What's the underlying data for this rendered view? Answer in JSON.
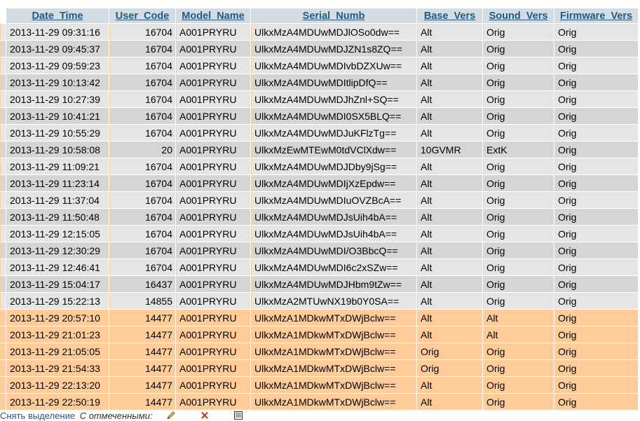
{
  "table": {
    "columns": [
      {
        "label": "Date_Time"
      },
      {
        "label": "User_Code"
      },
      {
        "label": "Model_Name"
      },
      {
        "label": "Serial_Numb"
      },
      {
        "label": "Base_Vers"
      },
      {
        "label": "Sound_Vers"
      },
      {
        "label": "Firmware_Vers"
      }
    ],
    "rows": [
      {
        "style": "odd",
        "cells": [
          "2013-11-29 09:31:16",
          "16704",
          "A001PRYRU",
          "UlkxMzA4MDUwMDJlOSo0dw==",
          "Alt",
          "Orig",
          "Orig"
        ]
      },
      {
        "style": "even",
        "cells": [
          "2013-11-29 09:45:37",
          "16704",
          "A001PRYRU",
          "UlkxMzA4MDUwMDJZN1s8ZQ==",
          "Alt",
          "Orig",
          "Orig"
        ]
      },
      {
        "style": "odd",
        "cells": [
          "2013-11-29 09:59:23",
          "16704",
          "A001PRYRU",
          "UlkxMzA4MDUwMDIvbDZXUw==",
          "Alt",
          "Orig",
          "Orig"
        ]
      },
      {
        "style": "even",
        "cells": [
          "2013-11-29 10:13:42",
          "16704",
          "A001PRYRU",
          "UlkxMzA4MDUwMDItlipDfQ==",
          "Alt",
          "Orig",
          "Orig"
        ]
      },
      {
        "style": "odd",
        "cells": [
          "2013-11-29 10:27:39",
          "16704",
          "A001PRYRU",
          "UlkxMzA4MDUwMDJhZnl+SQ==",
          "Alt",
          "Orig",
          "Orig"
        ]
      },
      {
        "style": "even",
        "cells": [
          "2013-11-29 10:41:21",
          "16704",
          "A001PRYRU",
          "UlkxMzA4MDUwMDI0SX5BLQ==",
          "Alt",
          "Orig",
          "Orig"
        ]
      },
      {
        "style": "odd",
        "cells": [
          "2013-11-29 10:55:29",
          "16704",
          "A001PRYRU",
          "UlkxMzA4MDUwMDJuKFlzTg==",
          "Alt",
          "Orig",
          "Orig"
        ]
      },
      {
        "style": "even",
        "cells": [
          "2013-11-29 10:58:08",
          "20",
          "A001PRYRU",
          "UlkxMzEwMTEwM0tdVClXdw==",
          "10GVMR",
          "ExtK",
          "Orig"
        ]
      },
      {
        "style": "odd",
        "cells": [
          "2013-11-29 11:09:21",
          "16704",
          "A001PRYRU",
          "UlkxMzA4MDUwMDJDby9jSg==",
          "Alt",
          "Orig",
          "Orig"
        ]
      },
      {
        "style": "even",
        "cells": [
          "2013-11-29 11:23:14",
          "16704",
          "A001PRYRU",
          "UlkxMzA4MDUwMDIjXzEpdw==",
          "Alt",
          "Orig",
          "Orig"
        ]
      },
      {
        "style": "odd",
        "cells": [
          "2013-11-29 11:37:04",
          "16704",
          "A001PRYRU",
          "UlkxMzA4MDUwMDIuOVZBcA==",
          "Alt",
          "Orig",
          "Orig"
        ]
      },
      {
        "style": "even",
        "cells": [
          "2013-11-29 11:50:48",
          "16704",
          "A001PRYRU",
          "UlkxMzA4MDUwMDJsUih4bA==",
          "Alt",
          "Orig",
          "Orig"
        ]
      },
      {
        "style": "odd",
        "cells": [
          "2013-11-29 12:15:05",
          "16704",
          "A001PRYRU",
          "UlkxMzA4MDUwMDJsUih4bA==",
          "Alt",
          "Orig",
          "Orig"
        ]
      },
      {
        "style": "even",
        "cells": [
          "2013-11-29 12:30:29",
          "16704",
          "A001PRYRU",
          "UlkxMzA4MDUwMDI/O3BbcQ==",
          "Alt",
          "Orig",
          "Orig"
        ]
      },
      {
        "style": "odd",
        "cells": [
          "2013-11-29 12:46:41",
          "16704",
          "A001PRYRU",
          "UlkxMzA4MDUwMDI6c2xSZw==",
          "Alt",
          "Orig",
          "Orig"
        ]
      },
      {
        "style": "even",
        "cells": [
          "2013-11-29 15:04:17",
          "16437",
          "A001PRYRU",
          "UlkxMzA4MDUwMDJHbm9tZw==",
          "Alt",
          "Orig",
          "Orig"
        ]
      },
      {
        "style": "odd",
        "cells": [
          "2013-11-29 15:22:13",
          "14855",
          "A001PRYRU",
          "UlkxMzA2MTUwNX19b0Y0SA==",
          "Alt",
          "Orig",
          "Orig"
        ]
      },
      {
        "style": "marked",
        "cells": [
          "2013-11-29 20:57:10",
          "14477",
          "A001PRYRU",
          "UlkxMzA1MDkwMTxDWjBclw==",
          "Alt",
          "Alt",
          "Orig"
        ]
      },
      {
        "style": "marked",
        "cells": [
          "2013-11-29 21:01:23",
          "14477",
          "A001PRYRU",
          "UlkxMzA1MDkwMTxDWjBclw==",
          "Alt",
          "Alt",
          "Orig"
        ]
      },
      {
        "style": "marked",
        "cells": [
          "2013-11-29 21:05:05",
          "14477",
          "A001PRYRU",
          "UlkxMzA1MDkwMTxDWjBclw==",
          "Orig",
          "Orig",
          "Orig"
        ]
      },
      {
        "style": "marked",
        "cells": [
          "2013-11-29 21:54:33",
          "14477",
          "A001PRYRU",
          "UlkxMzA1MDkwMTxDWjBclw==",
          "Orig",
          "Orig",
          "Orig"
        ]
      },
      {
        "style": "marked",
        "cells": [
          "2013-11-29 22:13:20",
          "14477",
          "A001PRYRU",
          "UlkxMzA1MDkwMTxDWjBclw==",
          "Alt",
          "Orig",
          "Orig"
        ]
      },
      {
        "style": "marked",
        "cells": [
          "2013-11-29 22:50:19",
          "14477",
          "A001PRYRU",
          "UlkxMzA1MDkwMTxDWjBclw==",
          "Alt",
          "Orig",
          "Orig"
        ]
      }
    ]
  },
  "footer": {
    "uncheck_all": "Снять выделение",
    "with_selected": "С отмеченными:"
  },
  "colors": {
    "header_bg": "#d3dce3",
    "header_text": "#235a81",
    "row_odd": "#e5e5e5",
    "row_even": "#d5d5d5",
    "row_marked": "#ffcc99"
  },
  "icons": {
    "edit": "pencil-icon",
    "delete": "delete-icon",
    "export": "export-icon"
  }
}
